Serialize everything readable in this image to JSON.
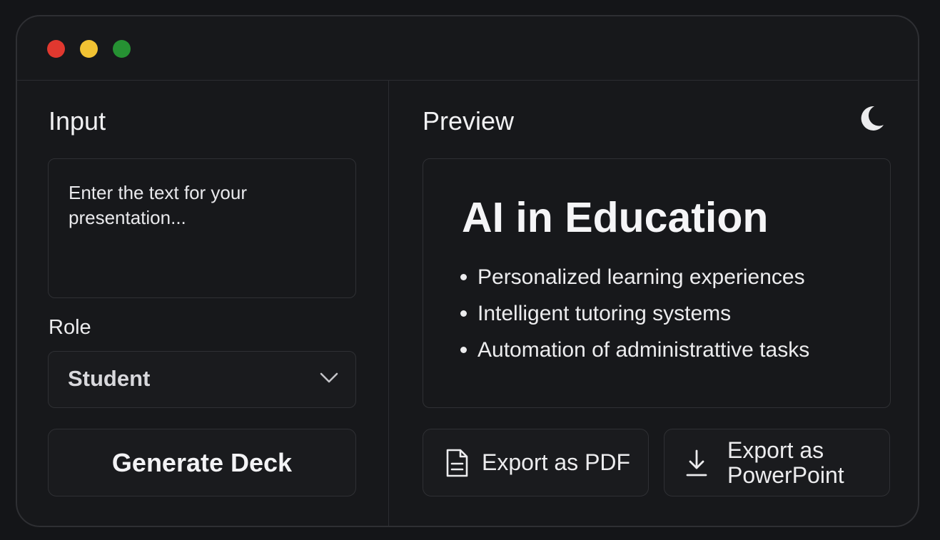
{
  "window": {
    "controls": [
      "close",
      "minimize",
      "maximize"
    ],
    "colors": {
      "close": "#e0382f",
      "minimize": "#f1c233",
      "maximize": "#269133"
    }
  },
  "input_panel": {
    "title": "Input",
    "textarea": {
      "placeholder": "Enter the text for your presentation..."
    },
    "role": {
      "label": "Role",
      "selected": "Student"
    },
    "generate_button": "Generate Deck"
  },
  "preview_panel": {
    "title": "Preview",
    "theme_toggle_icon": "moon-icon",
    "slide": {
      "title": "AI in Education",
      "bullets": [
        "Personalized learning experiences",
        "Intelligent tutoring systems",
        "Automation of administrattive tasks"
      ]
    },
    "export_pdf": {
      "label": "Export as PDF",
      "icon": "document-icon"
    },
    "export_ppt": {
      "label_line1": "Export as",
      "label_line2": "PowerPoint",
      "icon": "download-icon"
    }
  }
}
